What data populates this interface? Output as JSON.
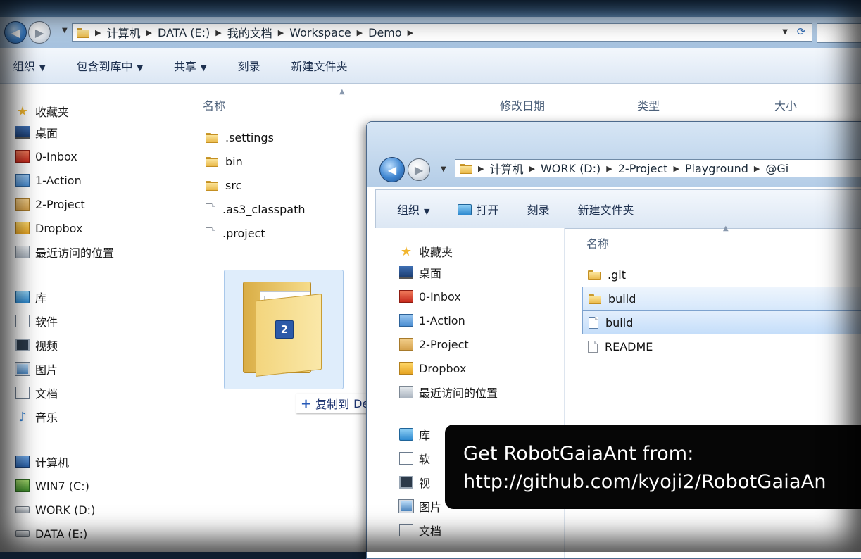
{
  "window_back": {
    "breadcrumb": [
      "计算机",
      "DATA (E:)",
      "我的文档",
      "Workspace",
      "Demo"
    ],
    "toolbar": {
      "organize": "组织",
      "include_library": "包含到库中",
      "share": "共享",
      "burn": "刻录",
      "new_folder": "新建文件夹"
    },
    "columns": {
      "name": "名称",
      "modified": "修改日期",
      "type": "类型",
      "size": "大小"
    },
    "files": [
      {
        "name": ".settings",
        "kind": "folder"
      },
      {
        "name": "bin",
        "kind": "folder"
      },
      {
        "name": "src",
        "kind": "folder"
      },
      {
        "name": ".as3_classpath",
        "kind": "file"
      },
      {
        "name": ".project",
        "kind": "file"
      }
    ],
    "nav": {
      "favorites": "收藏夹",
      "favorite_items": [
        "桌面",
        "0-Inbox",
        "1-Action",
        "2-Project",
        "Dropbox",
        "最近访问的位置"
      ],
      "library": "库",
      "library_items": [
        "软件",
        "视频",
        "图片",
        "文档",
        "音乐"
      ],
      "computer": "计算机",
      "drives": [
        "WIN7 (C:)",
        "WORK (D:)",
        "DATA (E:)"
      ]
    }
  },
  "drag": {
    "count_badge": "2",
    "tooltip_action": "复制到",
    "tooltip_target": "Demo"
  },
  "window_front": {
    "breadcrumb": [
      "计算机",
      "WORK (D:)",
      "2-Project",
      "Playground",
      "@Gi"
    ],
    "toolbar": {
      "organize": "组织",
      "open": "打开",
      "burn": "刻录",
      "new_folder": "新建文件夹"
    },
    "columns": {
      "name": "名称"
    },
    "files": [
      {
        "name": ".git",
        "kind": "folder"
      },
      {
        "name": "build",
        "kind": "folder",
        "selected": true
      },
      {
        "name": "build",
        "kind": "file",
        "selected": true
      },
      {
        "name": "README",
        "kind": "file"
      }
    ],
    "nav": {
      "favorites": "收藏夹",
      "favorite_items": [
        "桌面",
        "0-Inbox",
        "1-Action",
        "2-Project",
        "Dropbox",
        "最近访问的位置"
      ],
      "library": "库",
      "library_items": [
        "软",
        "视",
        "图片",
        "文档"
      ]
    }
  },
  "overlay": {
    "line1": "Get RobotGaiaAnt from:",
    "line2": "http://github.com/kyoji2/RobotGaiaAn"
  },
  "colors": {
    "selection_border": "#84acdd",
    "accent": "#2c5aa8"
  }
}
